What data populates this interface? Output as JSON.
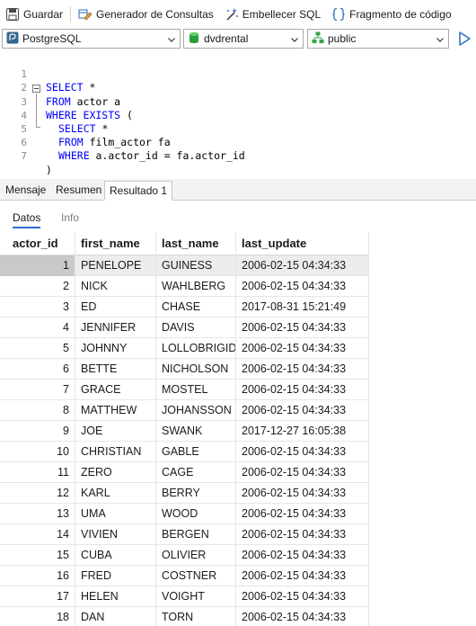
{
  "toolbar": {
    "save_label": "Guardar",
    "query_builder_label": "Generador de Consultas",
    "beautify_label": "Embellecer SQL",
    "snippet_label": "Fragmento de código"
  },
  "selectors": {
    "connection": "PostgreSQL",
    "database": "dvdrental",
    "schema": "public"
  },
  "editor": {
    "line_numbers": [
      "1",
      "2",
      "3",
      "4",
      "5",
      "6",
      "7"
    ],
    "lines": [
      {
        "kw": "SELECT",
        "rest": " *"
      },
      {
        "kw": "FROM",
        "rest": " actor a"
      },
      {
        "kw": "WHERE EXISTS",
        "rest": " ("
      },
      {
        "kw": "SELECT",
        "rest": " *"
      },
      {
        "kw": "FROM",
        "rest": " film_actor fa"
      },
      {
        "kw": "WHERE",
        "rest": " a.actor_id = fa.actor_id"
      },
      {
        "kw": "",
        "rest": ")"
      }
    ]
  },
  "result_tabs": [
    "Mensaje",
    "Resumen",
    "Resultado 1"
  ],
  "sub_tabs": [
    "Datos",
    "Info"
  ],
  "grid": {
    "columns": [
      "actor_id",
      "first_name",
      "last_name",
      "last_update"
    ],
    "rows": [
      [
        "1",
        "PENELOPE",
        "GUINESS",
        "2006-02-15 04:34:33"
      ],
      [
        "2",
        "NICK",
        "WAHLBERG",
        "2006-02-15 04:34:33"
      ],
      [
        "3",
        "ED",
        "CHASE",
        "2017-08-31 15:21:49"
      ],
      [
        "4",
        "JENNIFER",
        "DAVIS",
        "2006-02-15 04:34:33"
      ],
      [
        "5",
        "JOHNNY",
        "LOLLOBRIGID.",
        "2006-02-15 04:34:33"
      ],
      [
        "6",
        "BETTE",
        "NICHOLSON",
        "2006-02-15 04:34:33"
      ],
      [
        "7",
        "GRACE",
        "MOSTEL",
        "2006-02-15 04:34:33"
      ],
      [
        "8",
        "MATTHEW",
        "JOHANSSON",
        "2006-02-15 04:34:33"
      ],
      [
        "9",
        "JOE",
        "SWANK",
        "2017-12-27 16:05:38"
      ],
      [
        "10",
        "CHRISTIAN",
        "GABLE",
        "2006-02-15 04:34:33"
      ],
      [
        "11",
        "ZERO",
        "CAGE",
        "2006-02-15 04:34:33"
      ],
      [
        "12",
        "KARL",
        "BERRY",
        "2006-02-15 04:34:33"
      ],
      [
        "13",
        "UMA",
        "WOOD",
        "2006-02-15 04:34:33"
      ],
      [
        "14",
        "VIVIEN",
        "BERGEN",
        "2006-02-15 04:34:33"
      ],
      [
        "15",
        "CUBA",
        "OLIVIER",
        "2006-02-15 04:34:33"
      ],
      [
        "16",
        "FRED",
        "COSTNER",
        "2006-02-15 04:34:33"
      ],
      [
        "17",
        "HELEN",
        "VOIGHT",
        "2006-02-15 04:34:33"
      ],
      [
        "18",
        "DAN",
        "TORN",
        "2006-02-15 04:34:33"
      ]
    ]
  },
  "colors": {
    "keyword": "#0000ff",
    "active_subtab_underline": "#2b6cd6",
    "selected_cell": "#c9c9c9"
  },
  "icons": [
    "save-icon",
    "query-builder-icon",
    "beautify-icon",
    "snippet-icon",
    "postgresql-icon",
    "database-icon",
    "schema-icon",
    "run-icon"
  ]
}
